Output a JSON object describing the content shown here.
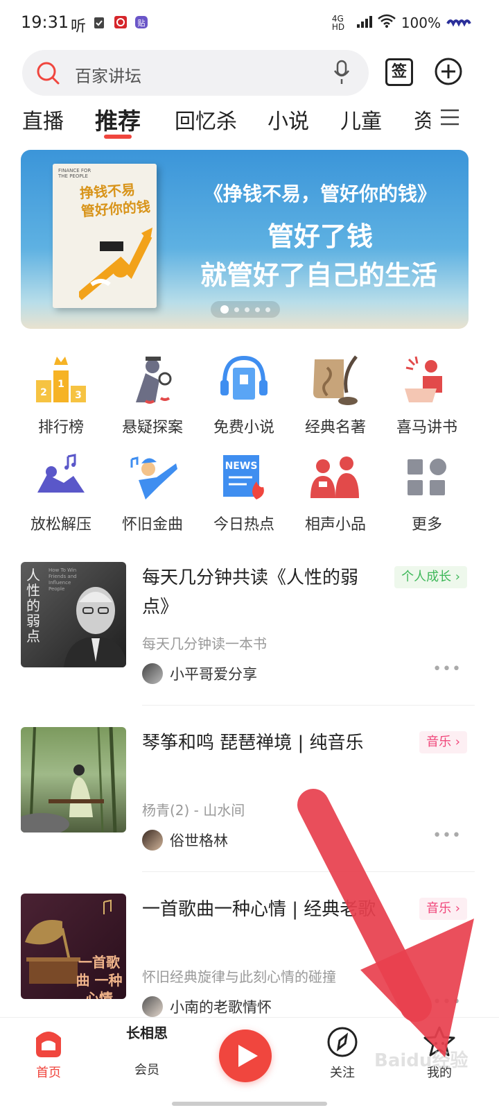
{
  "status": {
    "time": "19:31",
    "listen_icon": "听",
    "network": "4G HD",
    "battery": "100%"
  },
  "search": {
    "placeholder": "百家讲坛"
  },
  "header": {
    "checkin_label": "签"
  },
  "tabs": [
    {
      "label": "直播"
    },
    {
      "label": "推荐"
    },
    {
      "label": "回忆杀"
    },
    {
      "label": "小说"
    },
    {
      "label": "儿童"
    },
    {
      "label": "资"
    }
  ],
  "banner": {
    "line1": "《挣钱不易，管好你的钱》",
    "line2": "管好了钱",
    "line3": "就管好了自己的生活",
    "book_title": "挣钱不易 管好你的钱",
    "book_en": "FINANCE FOR THE PEOPLE",
    "slide_count": 5,
    "active_slide": 1
  },
  "categories": [
    {
      "label": "排行榜",
      "icon": "ranking-podium-icon"
    },
    {
      "label": "悬疑探案",
      "icon": "detective-icon"
    },
    {
      "label": "免费小说",
      "icon": "headphone-book-icon"
    },
    {
      "label": "经典名著",
      "icon": "scroll-quill-icon"
    },
    {
      "label": "喜马讲书",
      "icon": "lecturer-icon"
    },
    {
      "label": "放松解压",
      "icon": "relax-music-icon"
    },
    {
      "label": "怀旧金曲",
      "icon": "singer-icon"
    },
    {
      "label": "今日热点",
      "icon": "news-icon"
    },
    {
      "label": "相声小品",
      "icon": "crosstalk-icon"
    },
    {
      "label": "更多",
      "icon": "more-grid-icon"
    }
  ],
  "feed": [
    {
      "title": "每天几分钟共读《人性的弱点》",
      "tag": "个人成长",
      "subtitle": "每天几分钟读一本书",
      "author": "小平哥爱分享",
      "cover_text": "人性的弱点",
      "cover_en": "How To Win Friends and Influence People"
    },
    {
      "title": "琴筝和鸣 琵琶禅境 | 纯音乐",
      "tag": "音乐",
      "subtitle": "杨青(2) - 山水间",
      "author": "俗世格林"
    },
    {
      "title": "一首歌曲一种心情 | 经典老歌",
      "tag": "音乐",
      "subtitle": "怀旧经典旋律与此刻心情的碰撞",
      "author": "小南的老歌情怀",
      "cover_text": "一首歌曲 一种心情"
    }
  ],
  "bottom_nav": [
    {
      "label": "首页"
    },
    {
      "label": "会员",
      "logo_text": "长相思"
    },
    {
      "label": "关注"
    },
    {
      "label": "我的"
    }
  ],
  "watermark": "Baidu经验",
  "colors": {
    "accent": "#f0463e",
    "banner": "#4aa3df",
    "growth_tag": "#3fb85a",
    "music_tag": "#f0467a"
  }
}
